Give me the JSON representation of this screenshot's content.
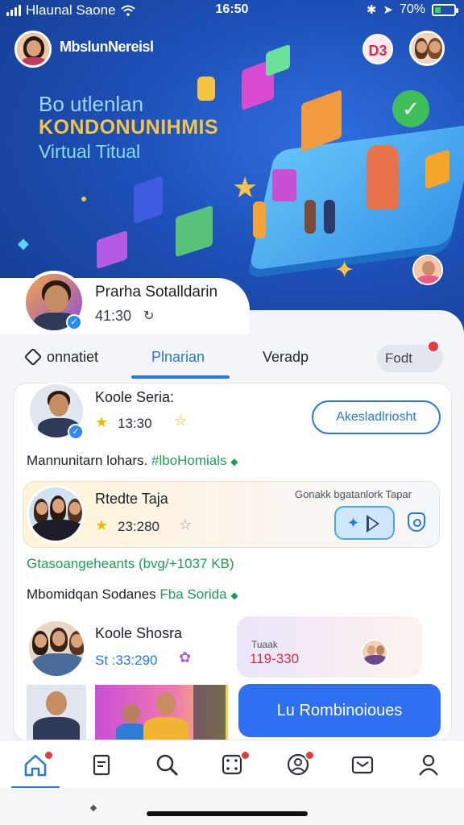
{
  "status_bar": {
    "carrier": "Hlaunal Saone",
    "time": "16:50",
    "battery": "70%"
  },
  "hero": {
    "user_name": "MbslunNereisl",
    "badge_text": "D3",
    "title_line1": "Bo utlenlan",
    "title_line2": "KONDONUNIHMIS",
    "title_line3": "Virtual Titual"
  },
  "profile": {
    "name": "Prarha Sotalldarin",
    "time": "41:30"
  },
  "tabs": [
    {
      "label": "onnatiet"
    },
    {
      "label": "Plnarian"
    },
    {
      "label": "Veradp"
    },
    {
      "label": "Fodt"
    }
  ],
  "feed": {
    "row1": {
      "title": "Koole Seria:",
      "time": "13:30",
      "action_label": "Akesladlriosht"
    },
    "post1": {
      "text": "Mannunitarn lohars.",
      "tag": "#lboHomials"
    },
    "highlight": {
      "title": "Rtedte Taja",
      "time": "23:280",
      "side_text": "Gonakk bgatanlork Tapar"
    },
    "post2": {
      "text": "Gtasoangeheants (bvg/+1037 KB)"
    },
    "post3": {
      "text": "Mbomidqan Sodanes",
      "tag": "Fba Sorida"
    },
    "row3": {
      "title": "Koole Shosra",
      "time": "St :33:290"
    },
    "small_card": {
      "label": "Tuaak",
      "value": "119-330"
    },
    "cta_label": "Lu Rombinoioues"
  },
  "nav": [
    {
      "icon": "home-icon",
      "badge": true,
      "active": true
    },
    {
      "icon": "document-icon",
      "badge": false
    },
    {
      "icon": "search-icon",
      "badge": false
    },
    {
      "icon": "game-icon",
      "badge": true
    },
    {
      "icon": "profile-chat-icon",
      "badge": true
    },
    {
      "icon": "message-icon",
      "badge": false
    },
    {
      "icon": "user-icon",
      "badge": false
    }
  ],
  "colors": {
    "accent": "#2577e6",
    "cta": "#2f6ff2",
    "hero_bg": "#1d4fb6",
    "star": "#f2b800",
    "tag_green": "#1e9e55",
    "badge_red": "#e43b3b"
  }
}
